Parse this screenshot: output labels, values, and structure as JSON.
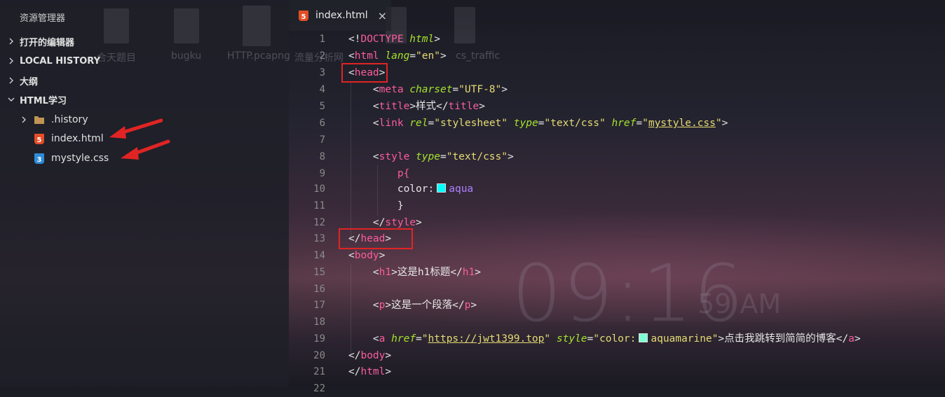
{
  "sidebar": {
    "title": "资源管理器",
    "sections": [
      {
        "label": "打开的编辑器",
        "expanded": false
      },
      {
        "label": "LOCAL HISTORY",
        "expanded": false
      },
      {
        "label": "大纲",
        "expanded": false
      },
      {
        "label": "HTML学习",
        "expanded": true
      }
    ],
    "files": [
      {
        "label": ".history",
        "icon": "folder-icon"
      },
      {
        "label": "index.html",
        "icon": "html5-icon",
        "badge": "5"
      },
      {
        "label": "mystyle.css",
        "icon": "css3-icon",
        "badge": "3"
      }
    ]
  },
  "desktop": {
    "icons": [
      "合天题目",
      "bugku",
      "HTTP.pcapng",
      "流量分析网",
      "cs_traffic"
    ],
    "clock": "09:16",
    "clock_sub": "59 AM"
  },
  "tab": {
    "label": "index.html",
    "close": "×"
  },
  "code_lines": [
    {
      "n": "1"
    },
    {
      "n": "2"
    },
    {
      "n": "3"
    },
    {
      "n": "4"
    },
    {
      "n": "5"
    },
    {
      "n": "6"
    },
    {
      "n": "7"
    },
    {
      "n": "8"
    },
    {
      "n": "9"
    },
    {
      "n": "10"
    },
    {
      "n": "11"
    },
    {
      "n": "12"
    },
    {
      "n": "13"
    },
    {
      "n": "14"
    },
    {
      "n": "15"
    },
    {
      "n": "16"
    },
    {
      "n": "17"
    },
    {
      "n": "18"
    },
    {
      "n": "19"
    },
    {
      "n": "20"
    },
    {
      "n": "21"
    },
    {
      "n": "22"
    }
  ],
  "code": {
    "l1": {
      "a": "<!",
      "b": "DOCTYPE",
      "c": " html",
      ">": ">"
    },
    "l2": {
      "tag": "html",
      "attr": "lang",
      "val": "\"en\""
    },
    "l3": {
      "tag": "head"
    },
    "l4": {
      "tag": "meta",
      "attr": "charset",
      "val": "\"UTF-8\""
    },
    "l5": {
      "tag": "title",
      "text": "样式",
      "close": "title"
    },
    "l6": {
      "tag": "link",
      "a1": "rel",
      "v1": "\"stylesheet\"",
      "a2": "type",
      "v2": "\"text/css\"",
      "a3": "href",
      "q1": "\"",
      "url": "mystyle.css",
      "q2": "\""
    },
    "l8": {
      "tag": "style",
      "attr": "type",
      "val": "\"text/css\""
    },
    "l9": {
      "text": "p{"
    },
    "l10": {
      "prop": "color:",
      "val": "aqua",
      "color": "#00ffff"
    },
    "l11": {
      "text": "}"
    },
    "l12": {
      "tag": "style"
    },
    "l13": {
      "tag": "head"
    },
    "l14": {
      "tag": "body"
    },
    "l15": {
      "tag": "h1",
      "text": "这是h1标题",
      "close": "h1"
    },
    "l17": {
      "tag": "p",
      "text": "这是一个段落",
      "close": "p"
    },
    "l19": {
      "tag": "a",
      "a1": "href",
      "q1": "\"",
      "url": "https://jwt1399.top",
      "q2": "\"",
      "a2": "style",
      "v2a": "\"color:",
      "v2b": "aquamarine\"",
      "color": "#7fffd4",
      "text": "点击我跳转到简简的博客",
      "close": "a"
    },
    "l20": {
      "tag": "body"
    },
    "l21": {
      "tag": "html"
    }
  },
  "colors": {
    "tag": "#fa5d9d",
    "attr": "#a6e22e",
    "string": "#e6db74",
    "value": "#ae81ff",
    "annotation": "#e02424"
  }
}
